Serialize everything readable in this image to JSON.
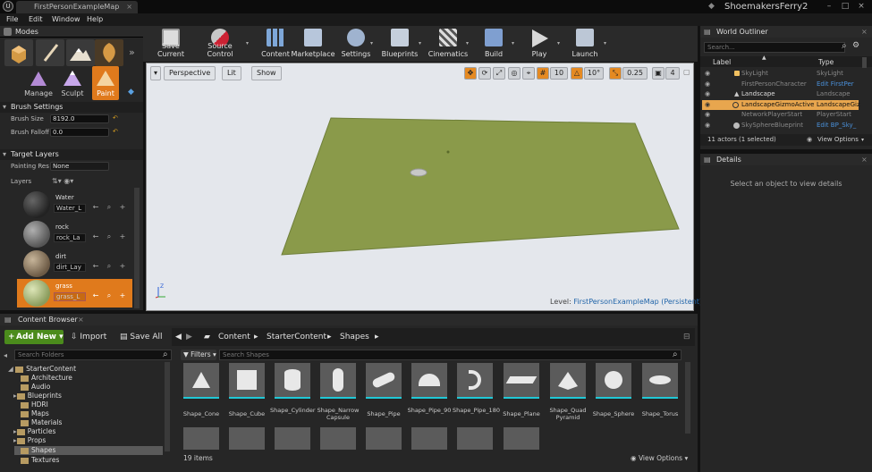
{
  "window": {
    "tab_title": "FirstPersonExampleMap",
    "project_name": "ShoemakersFerry2"
  },
  "menu": [
    "File",
    "Edit",
    "Window",
    "Help"
  ],
  "modes": {
    "title": "Modes",
    "labels": [
      "Manage",
      "Sculpt",
      "Paint"
    ],
    "brush_settings": {
      "title": "Brush Settings",
      "brush_size_label": "Brush Size",
      "brush_size_value": "8192.0",
      "brush_falloff_label": "Brush Falloff",
      "brush_falloff_value": "0.0"
    },
    "target_layers": {
      "title": "Target Layers",
      "painting_label": "Painting Res",
      "painting_value": "None",
      "layers_label": "Layers",
      "layers": [
        {
          "name": "Water",
          "asset": "Water_L"
        },
        {
          "name": "rock",
          "asset": "rock_La"
        },
        {
          "name": "dirt",
          "asset": "dirt_Lay"
        },
        {
          "name": "grass",
          "asset": "grass_L"
        }
      ]
    }
  },
  "toolbar": [
    "Save Current",
    "Source Control",
    "Content",
    "Marketplace",
    "Settings",
    "Blueprints",
    "Cinematics",
    "Build",
    "Play",
    "Launch"
  ],
  "viewport": {
    "perspective": "Perspective",
    "lit": "Lit",
    "show": "Show",
    "grid_snap": "10",
    "rot_snap": "10°",
    "scale_snap": "0.25",
    "camera_speed": "4",
    "level_label": "Level:",
    "level_name": "FirstPersonExampleMap (Persistent)",
    "axis_z": "Z"
  },
  "world_outliner": {
    "title": "World Outliner",
    "search_placeholder": "Search...",
    "col_label": "Label",
    "col_type": "Type",
    "rows": [
      {
        "label": "SkyLight",
        "type": "SkyLight"
      },
      {
        "label": "FirstPersonCharacter",
        "type": "Edit FirstPer"
      },
      {
        "label": "Landscape",
        "type": "Landscape"
      },
      {
        "label": "LandscapeGizmoActive",
        "type": "LandscapeGiz"
      },
      {
        "label": "NetworkPlayerStart",
        "type": "PlayerStart"
      },
      {
        "label": "SkySphereBlueprint",
        "type": "Edit BP_Sky_"
      }
    ],
    "status": "11 actors (1 selected)",
    "view_options": "View Options"
  },
  "details": {
    "title": "Details",
    "empty_msg": "Select an object to view details"
  },
  "content_browser": {
    "title": "Content Browser",
    "add_new": "Add New",
    "import": "Import",
    "save_all": "Save All",
    "path": [
      "Content",
      "StarterContent",
      "Shapes"
    ],
    "folder_search_placeholder": "Search Folders",
    "tree": [
      "StarterContent",
      "Architecture",
      "Audio",
      "Blueprints",
      "HDRI",
      "Maps",
      "Materials",
      "Particles",
      "Props",
      "Shapes",
      "Textures"
    ],
    "filters": "Filters",
    "asset_search_placeholder": "Search Shapes",
    "assets": [
      "Shape_Cone",
      "Shape_Cube",
      "Shape_Cylinder",
      "Shape_Narrow Capsule",
      "Shape_Pipe",
      "Shape_Pipe_90",
      "Shape_Pipe_180",
      "Shape_Plane",
      "Shape_Quad Pyramid",
      "Shape_Sphere",
      "Shape_Torus"
    ],
    "item_count": "19 items",
    "view_options": "View Options"
  }
}
